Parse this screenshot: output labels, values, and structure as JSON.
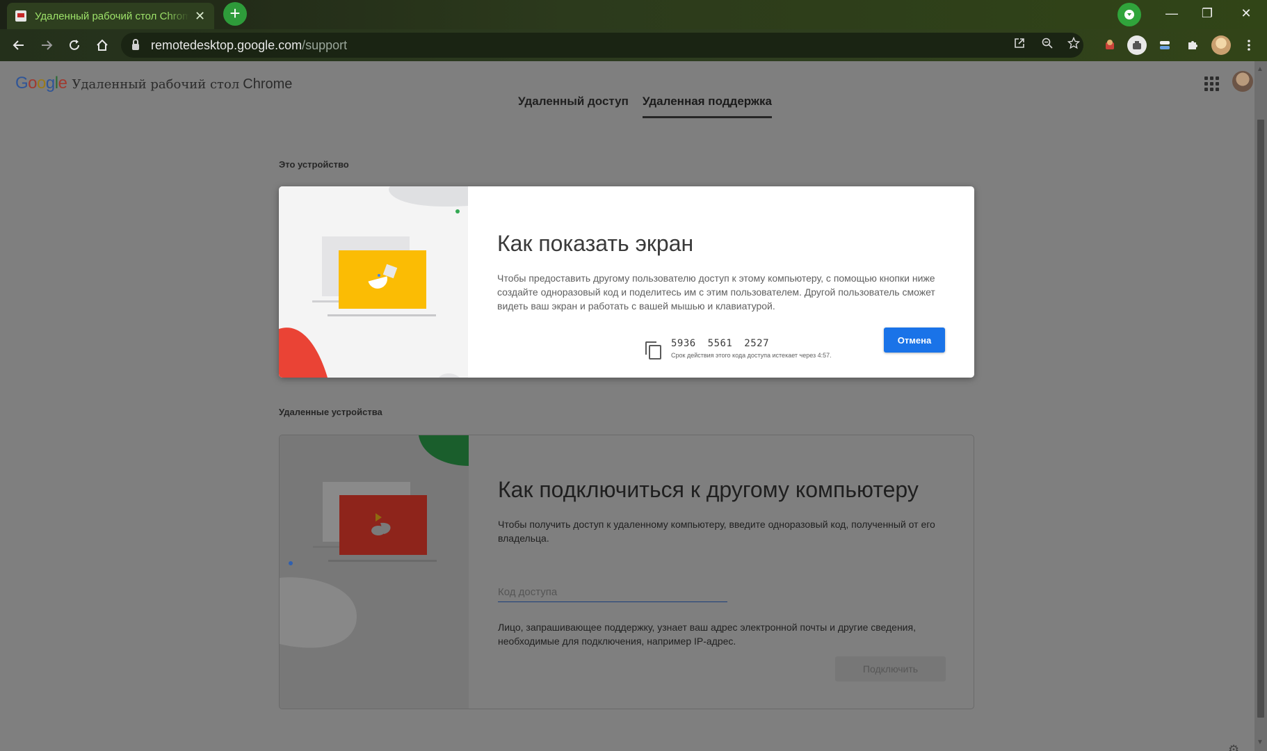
{
  "browser": {
    "tab_title": "Удаленный рабочий стол Chrome",
    "tab_close": "✕",
    "new_tab": "+",
    "url_host": "remotedesktop.google.com",
    "url_path": "/support",
    "window_controls": {
      "minimize": "—",
      "restore": "❐",
      "close": "✕"
    },
    "icons": [
      "back-icon",
      "forward-icon",
      "reload-icon",
      "home-icon",
      "lock-icon",
      "open-in-app-icon",
      "zoom-icon",
      "star-icon",
      "extension-icon",
      "puzzle-icon",
      "profile-icon",
      "menu-icon"
    ]
  },
  "header": {
    "logo_letters": [
      "G",
      "o",
      "o",
      "g",
      "l",
      "e"
    ],
    "product_name": "Удаленный рабочий стол",
    "product_suffix": "Chrome"
  },
  "nav": {
    "tabs": [
      {
        "label": "Удаленный доступ",
        "active": false
      },
      {
        "label": "Удаленная поддержка",
        "active": true
      }
    ]
  },
  "this_device": {
    "section_label": "Это устройство",
    "title": "Как показать экран",
    "description": "Чтобы предоставить другому пользователю доступ к этому компьютеру, с помощью кнопки ниже создайте одноразовый код и поделитесь им с этим пользователем. Другой пользователь сможет видеть ваш экран и работать с вашей мышью и клавиатурой.",
    "code": "5936  5561  2527",
    "expire_text": "Срок действия этого кода доступа истекает через 4:57.",
    "cancel_button": "Отмена"
  },
  "remote_devices": {
    "section_label": "Удаленные устройства",
    "title": "Как подключиться к другому компьютеру",
    "description": "Чтобы получить доступ к удаленному компьютеру, введите одноразовый код, полученный от его владельца.",
    "input_placeholder": "Код доступа",
    "input_value": "",
    "notice": "Лицо, запрашивающее поддержку, узнает ваш адрес электронной почты и другие сведения, необходимые для подключения, например IP-адрес.",
    "connect_button": "Подключить"
  },
  "colors": {
    "accent_blue": "#1a73e8",
    "illustration_yellow": "#fbbc04",
    "illustration_red": "#ea4335",
    "illustration_green": "#34a853"
  }
}
